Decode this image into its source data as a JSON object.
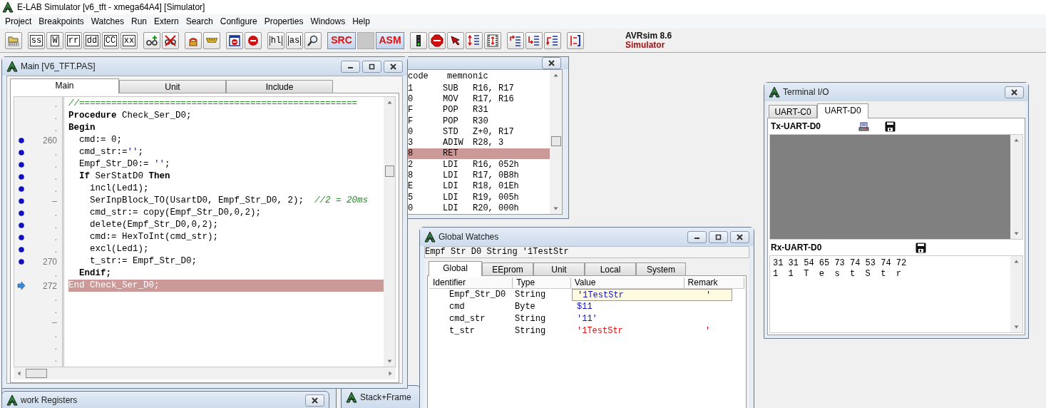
{
  "app": {
    "title": "E-LAB Simulator [v6_tft - xmega64A4] [Simulator]"
  },
  "menu": [
    "Project",
    "Breakpoints",
    "Watches",
    "Run",
    "Extern",
    "Search",
    "Configure",
    "Properties",
    "Windows",
    "Help"
  ],
  "toolbar": [
    [
      {
        "kind": "folder"
      }
    ],
    [
      {
        "kind": "label",
        "text": "ss"
      },
      {
        "kind": "label",
        "text": "W"
      },
      {
        "kind": "label",
        "text": "rr"
      },
      {
        "kind": "label",
        "text": "dd"
      },
      {
        "kind": "label",
        "text": "CC"
      },
      {
        "kind": "label",
        "text": "xx"
      }
    ],
    [
      {
        "kind": "glassesadd"
      },
      {
        "kind": "glassesremove"
      }
    ],
    [
      {
        "kind": "phone"
      },
      {
        "kind": "plug"
      }
    ],
    [
      {
        "kind": "windowstop"
      },
      {
        "kind": "stop"
      }
    ],
    [
      {
        "kind": "scroll",
        "text": "hl"
      },
      {
        "kind": "scroll",
        "text": "as"
      },
      {
        "kind": "magnifier"
      }
    ],
    [
      {
        "kind": "mode",
        "text": "SRC"
      },
      {
        "kind": "blank"
      },
      {
        "kind": "mode",
        "text": "ASM"
      }
    ],
    [
      {
        "kind": "traffic"
      },
      {
        "kind": "stopsign"
      },
      {
        "kind": "cursor"
      },
      {
        "kind": "listarrows"
      },
      {
        "kind": "film"
      }
    ],
    [
      {
        "kind": "stepinto"
      },
      {
        "kind": "stepover"
      },
      {
        "kind": "stepout"
      }
    ],
    [
      {
        "kind": "stepreturn"
      }
    ]
  ],
  "product": {
    "name": "AVRsim 8.6",
    "mode": "Simulator"
  },
  "editor": {
    "title": "Main [V6_TFT.PAS]",
    "tabs": [
      {
        "label": "Main",
        "selected": true
      },
      {
        "label": "Unit",
        "selected": false
      },
      {
        "label": "Include",
        "selected": false
      }
    ],
    "lines": [
      {
        "gutter": ".",
        "breakpoint": false,
        "current": false,
        "segments": [
          {
            "kind": "comment",
            "text": "//===================================================="
          }
        ]
      },
      {
        "gutter": ".",
        "breakpoint": false,
        "current": false,
        "segments": [
          {
            "kind": "keyword",
            "text": "Procedure"
          },
          {
            "kind": "plain",
            "text": " Check_Ser_D0;"
          }
        ]
      },
      {
        "gutter": ".",
        "breakpoint": false,
        "current": false,
        "segments": [
          {
            "kind": "keyword",
            "text": "Begin"
          }
        ]
      },
      {
        "gutter": "260",
        "breakpoint": true,
        "current": false,
        "segments": [
          {
            "kind": "plain",
            "text": "  cmd:= 0;"
          }
        ]
      },
      {
        "gutter": ".",
        "breakpoint": true,
        "current": false,
        "segments": [
          {
            "kind": "plain",
            "text": "  cmd_str:="
          },
          {
            "kind": "string",
            "text": "''"
          },
          {
            "kind": "plain",
            "text": ";"
          }
        ]
      },
      {
        "gutter": ".",
        "breakpoint": true,
        "current": false,
        "segments": [
          {
            "kind": "plain",
            "text": "  Empf_Str_D0:= "
          },
          {
            "kind": "string",
            "text": "''"
          },
          {
            "kind": "plain",
            "text": ";"
          }
        ]
      },
      {
        "gutter": ".",
        "breakpoint": true,
        "current": false,
        "segments": [
          {
            "kind": "keyword",
            "text": "  If"
          },
          {
            "kind": "plain",
            "text": " SerStatD0 "
          },
          {
            "kind": "keyword",
            "text": "Then"
          }
        ]
      },
      {
        "gutter": ".",
        "breakpoint": true,
        "current": false,
        "segments": [
          {
            "kind": "plain",
            "text": "    incl(Led1);"
          }
        ]
      },
      {
        "gutter": "–",
        "breakpoint": true,
        "current": false,
        "segments": [
          {
            "kind": "plain",
            "text": "    SerInpBlock_TO(UsartD0, Empf_Str_D0, 2);  "
          },
          {
            "kind": "comment",
            "text": "//2 = 20ms"
          }
        ]
      },
      {
        "gutter": ".",
        "breakpoint": true,
        "current": false,
        "segments": [
          {
            "kind": "plain",
            "text": "    cmd_str:= copy(Empf_Str_D0,0,2);"
          }
        ]
      },
      {
        "gutter": ".",
        "breakpoint": true,
        "current": false,
        "segments": [
          {
            "kind": "plain",
            "text": "    delete(Empf_Str_D0,0,2);"
          }
        ]
      },
      {
        "gutter": ".",
        "breakpoint": true,
        "current": false,
        "segments": [
          {
            "kind": "plain",
            "text": "    cmd:= HexToInt(cmd_str);"
          }
        ]
      },
      {
        "gutter": ".",
        "breakpoint": true,
        "current": false,
        "segments": [
          {
            "kind": "plain",
            "text": "    excl(Led1);"
          }
        ]
      },
      {
        "gutter": "270",
        "breakpoint": true,
        "current": false,
        "segments": [
          {
            "kind": "plain",
            "text": "    t_str:= Empf_Str_D0;"
          }
        ]
      },
      {
        "gutter": ".",
        "breakpoint": false,
        "current": false,
        "segments": [
          {
            "kind": "keyword",
            "text": "  Endif;"
          }
        ]
      },
      {
        "gutter": "272",
        "breakpoint": false,
        "current": true,
        "segments": [
          {
            "kind": "plain",
            "text": "End Check_Ser_D0;"
          }
        ]
      },
      {
        "gutter": ".",
        "breakpoint": false,
        "current": false
      },
      {
        "gutter": ".",
        "breakpoint": false,
        "current": false
      },
      {
        "gutter": "–",
        "breakpoint": false,
        "current": false
      },
      {
        "gutter": ".",
        "breakpoint": false,
        "current": false
      },
      {
        "gutter": ".",
        "breakpoint": false,
        "current": false
      },
      {
        "gutter": ".",
        "breakpoint": false,
        "current": false
      }
    ]
  },
  "disassembly": {
    "columns": [
      "code",
      "memnonic"
    ],
    "rows": [
      {
        "code": "1",
        "op": "SUB",
        "args": "R16, R17",
        "selected": false
      },
      {
        "code": "0",
        "op": "MOV",
        "args": "R17, R16",
        "selected": false
      },
      {
        "code": "F",
        "op": "POP",
        "args": "R31",
        "selected": false
      },
      {
        "code": "F",
        "op": "POP",
        "args": "R30",
        "selected": false
      },
      {
        "code": "0",
        "op": "STD",
        "args": "Z+0, R17",
        "selected": false
      },
      {
        "code": "3",
        "op": "ADIW",
        "args": "R28, 3",
        "selected": false
      },
      {
        "code": "8",
        "op": "RET",
        "args": "",
        "selected": true
      },
      {
        "code": "2",
        "op": "LDI",
        "args": "R16, 052h",
        "selected": false
      },
      {
        "code": "8",
        "op": "LDI",
        "args": "R17, 0B8h",
        "selected": false
      },
      {
        "code": "E",
        "op": "LDI",
        "args": "R18, 01Eh",
        "selected": false
      },
      {
        "code": "5",
        "op": "LDI",
        "args": "R19, 005h",
        "selected": false
      },
      {
        "code": "0",
        "op": "LDI",
        "args": "R20, 000h",
        "selected": false
      }
    ]
  },
  "watches": {
    "title": "Global Watches",
    "info": "Empf Str D0 String '1TestStr",
    "tabs": [
      {
        "label": "Global",
        "selected": true
      },
      {
        "label": "EEprom",
        "selected": false
      },
      {
        "label": "Unit",
        "selected": false
      },
      {
        "label": "Local",
        "selected": false
      },
      {
        "label": "System",
        "selected": false
      }
    ],
    "columns": [
      "Identifier",
      "Type",
      "Value",
      "Remark"
    ],
    "rows": [
      {
        "identifier": "Empf_Str_D0",
        "type": "String",
        "value": "'1TestStr                '",
        "selected": true,
        "changed": false
      },
      {
        "identifier": "cmd",
        "type": "Byte",
        "value": "$11",
        "selected": false,
        "changed": false
      },
      {
        "identifier": "cmd_str",
        "type": "String",
        "value": "'11'",
        "selected": false,
        "changed": false
      },
      {
        "identifier": "t_str",
        "type": "String",
        "value": "'1TestStr                '",
        "selected": false,
        "changed": true
      }
    ]
  },
  "terminal": {
    "title": "Terminal I/O",
    "tabs": [
      {
        "label": "UART-C0",
        "selected": false
      },
      {
        "label": "UART-D0",
        "selected": true
      }
    ],
    "tx_label": "Tx-UART-D0",
    "rx_label": "Rx-UART-D0",
    "rx_lines": [
      "31 31 54 65 73 74 53 74 72",
      "1  1  T  e  s  t  S  t  r"
    ]
  },
  "bottom_windows": [
    {
      "title": "work Registers"
    },
    {
      "title": "Stack+Frame"
    }
  ]
}
